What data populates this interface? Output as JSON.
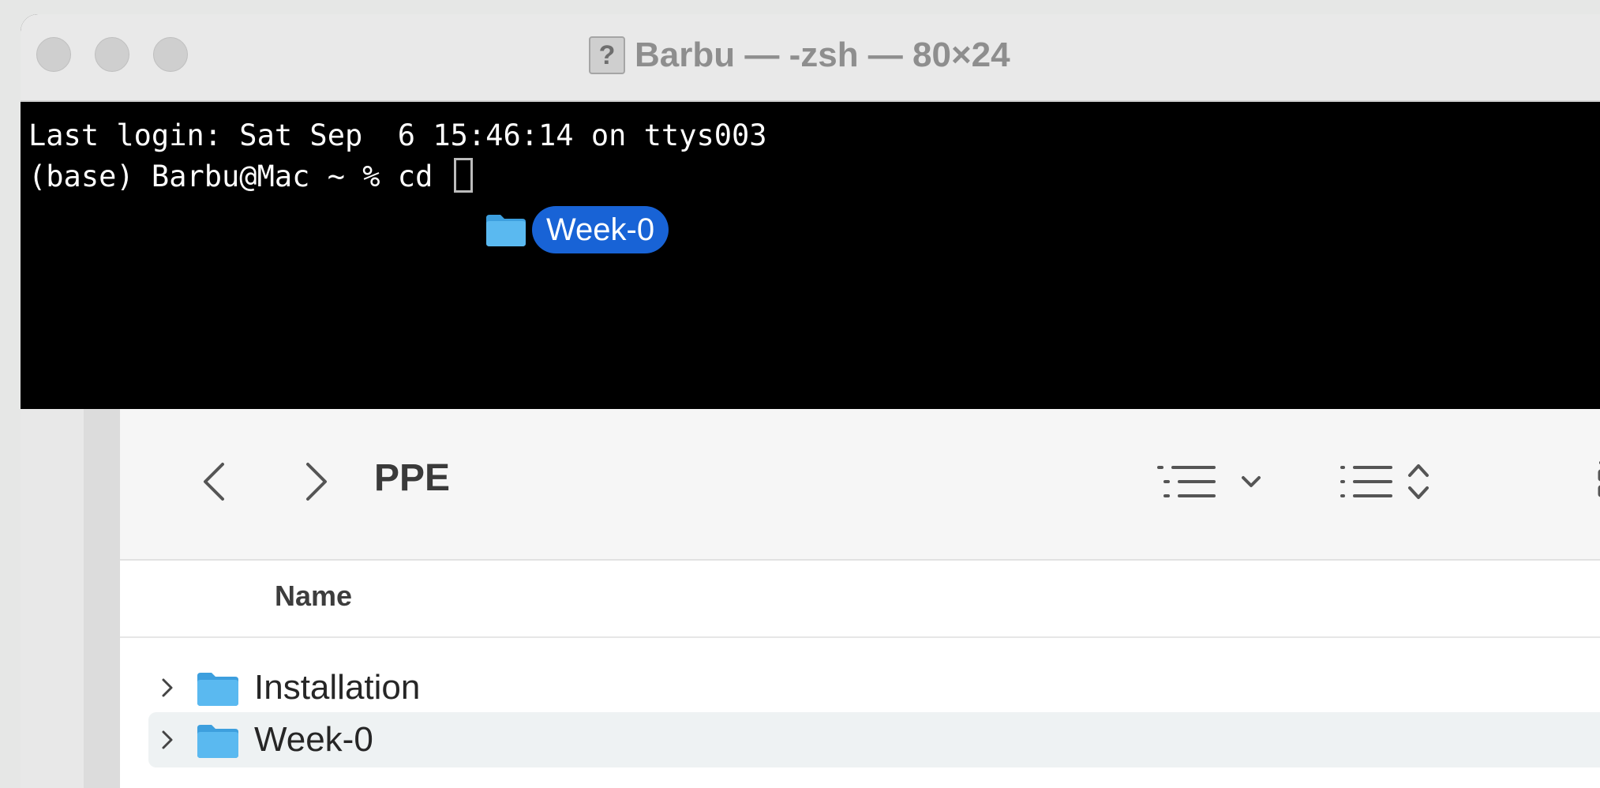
{
  "terminal": {
    "title": "Barbu — -zsh — 80×24",
    "title_icon": "?",
    "lines": [
      "Last login: Sat Sep  6 15:46:14 on ttys003",
      "(base) Barbu@Mac ~ % cd "
    ],
    "drag_item": {
      "icon": "folder-icon",
      "label": "Week-0"
    }
  },
  "finder": {
    "folder_title": "PPE",
    "column_header": "Name",
    "items": [
      {
        "name": "Installation",
        "icon": "folder-icon",
        "selected": false
      },
      {
        "name": "Week-0",
        "icon": "folder-icon",
        "selected": true
      }
    ]
  },
  "colors": {
    "folder": "#53b4ee",
    "selection": "#1863d6",
    "terminal_bg": "#000000"
  }
}
